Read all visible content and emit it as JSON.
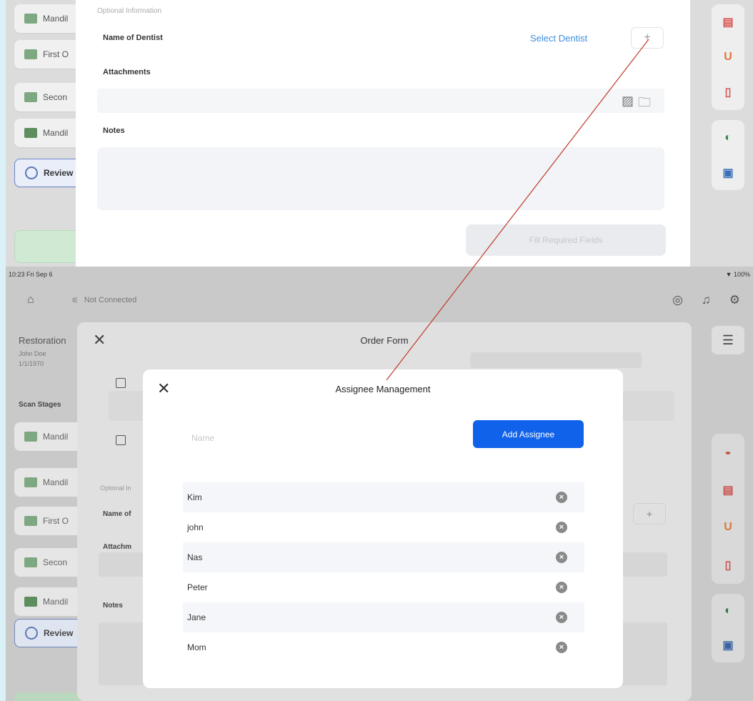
{
  "top": {
    "sidebar": [
      {
        "label": "Mandil",
        "icon": "stage-icon"
      },
      {
        "label": "First O",
        "icon": "stage-icon"
      },
      {
        "label": "Secon",
        "icon": "stage-icon"
      },
      {
        "label": "Mandil",
        "icon": "bite-icon"
      },
      {
        "label": "Review",
        "icon": "review-icon"
      }
    ],
    "section_label": "Optional Information",
    "dentist_label": "Name of Dentist",
    "select_dentist": "Select Dentist",
    "plus": "+",
    "attachments_label": "Attachments",
    "notes_label": "Notes",
    "fill_required": "Fill Required Fields"
  },
  "bottom": {
    "status_time": "10:23  Fri Sep 6",
    "status_battery": "▼ 100%",
    "nav_connection": "Not Connected",
    "left_title": "Restoration",
    "left_sub1": "John Doe",
    "left_sub2": "1/1/1970",
    "scan_stages": "Scan Stages",
    "sidebar": [
      {
        "label": "Mandil",
        "icon": "stage-icon"
      },
      {
        "label": "Mandil",
        "icon": "stage-icon"
      },
      {
        "label": "First O",
        "icon": "stage-icon"
      },
      {
        "label": "Secon",
        "icon": "stage-icon"
      },
      {
        "label": "Mandil",
        "icon": "bite-icon"
      },
      {
        "label": "Review",
        "icon": "review-icon"
      }
    ],
    "order_form": {
      "title": "Order Form",
      "optional": "Optional In",
      "dentist_label": "Name of",
      "attachments_label": "Attachm",
      "notes_label": "Notes",
      "plus": "+"
    }
  },
  "modal": {
    "title": "Assignee Management",
    "name_placeholder": "Name",
    "add_button": "Add Assignee",
    "assignees": [
      "Kim",
      "john",
      "Nas",
      "Peter",
      "Jane",
      "Mom"
    ]
  },
  "colors": {
    "accent": "#1162ea",
    "link": "#3f8ee0",
    "annotation": "#c0392b"
  }
}
